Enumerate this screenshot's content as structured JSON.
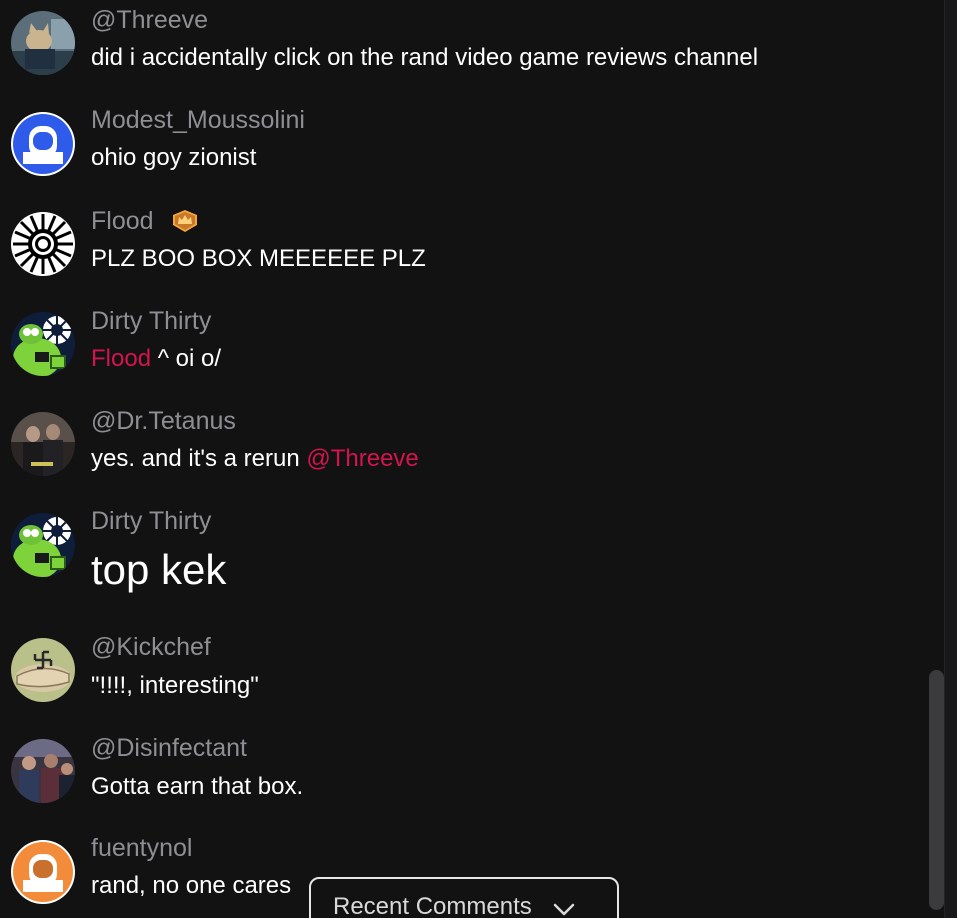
{
  "messages": [
    {
      "username": "@Threeve",
      "text_parts": [
        "did i accidentally click on the rand video game reviews channel"
      ],
      "avatar": "cat-at-desk-photo"
    },
    {
      "username": "Modest_Moussolini",
      "text_parts": [
        "ohio goy zionist"
      ],
      "avatar": "default-blue-astronaut"
    },
    {
      "username": "Flood",
      "badge": "crown-badge-icon",
      "text_parts": [
        "PLZ BOO BOX MEEEEEE PLZ"
      ],
      "avatar": "black-white-sun-emblem"
    },
    {
      "username": "Dirty Thirty",
      "mention": "Flood",
      "text_after": " ^ oi o/",
      "avatar": "green-frog-cartoon"
    },
    {
      "username": "@Dr.Tetanus",
      "text_before": "yes. and it's a rerun ",
      "mention": "@Threeve",
      "avatar": "movie-scene-photo"
    },
    {
      "username": "Dirty Thirty",
      "text_parts": [
        "top kek"
      ],
      "avatar": "green-frog-cartoon"
    },
    {
      "username": "@Kickchef",
      "text_parts": [
        "\"!!!!, interesting\""
      ],
      "avatar": "hand-photo"
    },
    {
      "username": "@Disinfectant",
      "text_parts": [
        "Gotta earn that box."
      ],
      "avatar": "crowd-photo"
    },
    {
      "username": "fuentynol",
      "text_parts": [
        "rand, no one cares"
      ],
      "avatar": "default-orange-astronaut"
    }
  ],
  "recent_comments": {
    "label": "Recent Comments",
    "icon": "chevron-down-icon"
  },
  "colors": {
    "background": "#121213",
    "username": "#8e8e93",
    "message_text": "#ffffff",
    "mention": "#d4144e",
    "default_avatar_blue": "#2f5bea",
    "default_avatar_orange": "#f28c3a"
  }
}
